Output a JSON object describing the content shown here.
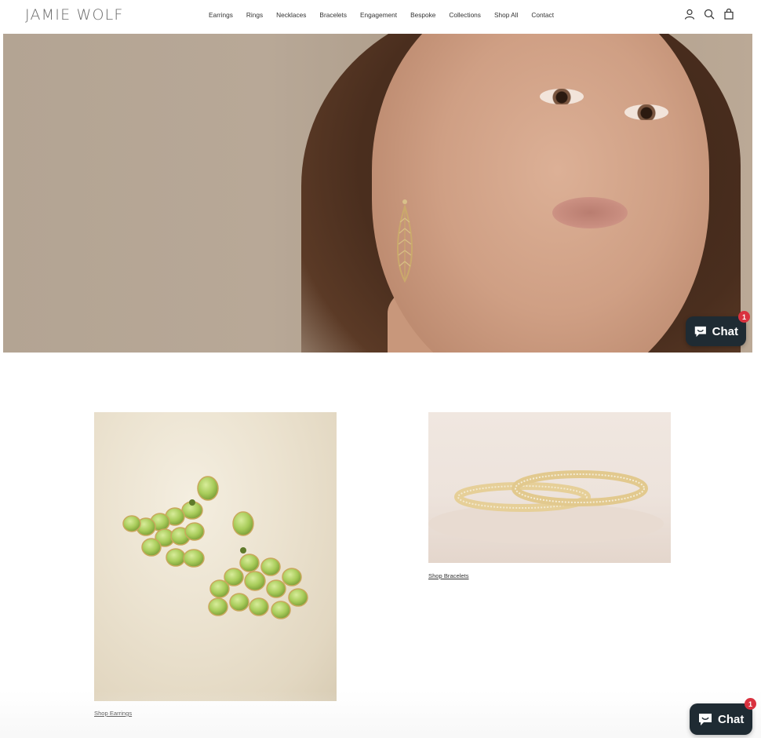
{
  "header": {
    "logo": "JAMIE WOLF",
    "nav": [
      "Earrings",
      "Rings",
      "Necklaces",
      "Bracelets",
      "Engagement",
      "Bespoke",
      "Collections",
      "Shop All",
      "Contact"
    ],
    "icons": [
      "account-icon",
      "search-icon",
      "cart-icon"
    ]
  },
  "chat": {
    "label": "Chat",
    "badge": "1",
    "color": "#1f2b33",
    "badge_color": "#d9323f"
  },
  "products": {
    "earrings_link": "Shop Earrings",
    "bracelets_link": "Shop Bracelets"
  }
}
